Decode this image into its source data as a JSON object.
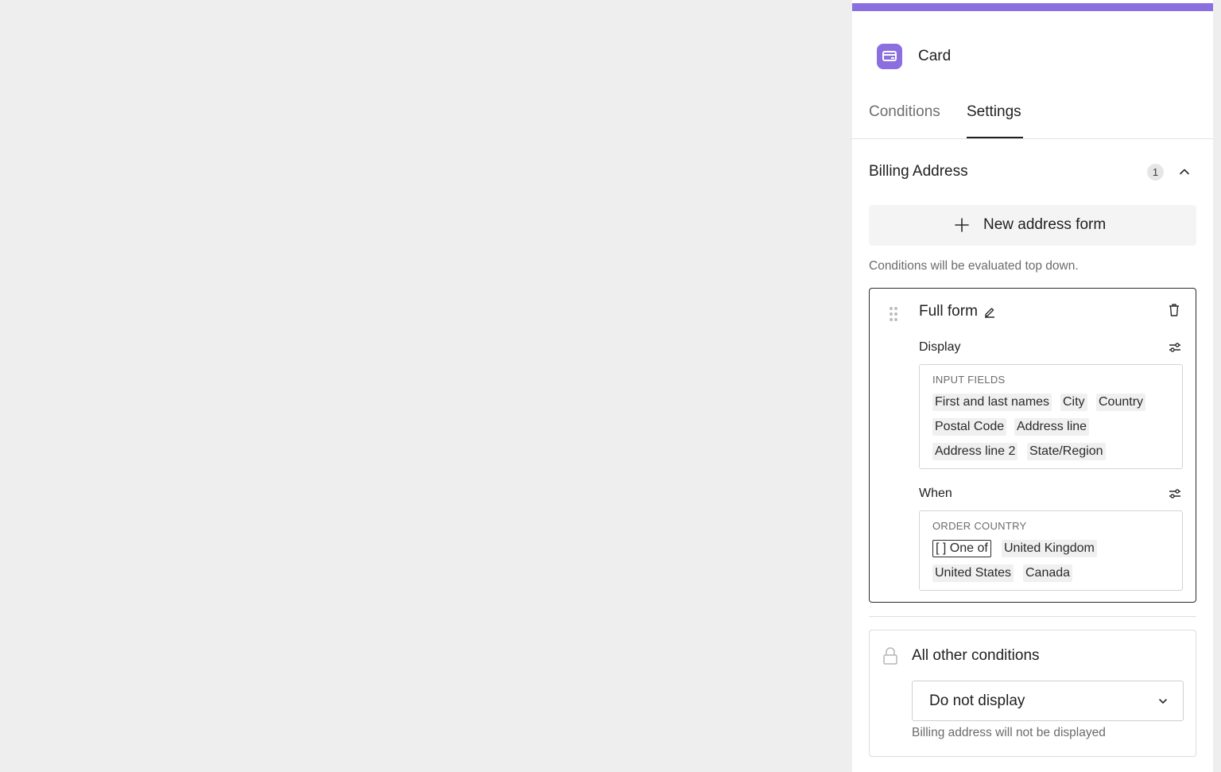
{
  "panel": {
    "accent_color": "#8b6fe0",
    "title": "Card",
    "title_icon": "card-icon"
  },
  "tabs": [
    {
      "label": "Conditions",
      "active": false
    },
    {
      "label": "Settings",
      "active": true
    }
  ],
  "section": {
    "title": "Billing Address",
    "count": "1",
    "collapse_icon": "chevron-up-icon"
  },
  "new_form_button": {
    "label": "New address form",
    "icon": "plus-icon"
  },
  "hint": "Conditions will be evaluated top down.",
  "rule": {
    "name": "Full form",
    "display": {
      "label": "Display",
      "box_heading": "INPUT FIELDS",
      "fields": [
        "First and last names",
        "City",
        "Country",
        "Postal Code",
        "Address line",
        "Address line 2",
        "State/Region"
      ]
    },
    "when": {
      "label": "When",
      "box_heading": "ORDER COUNTRY",
      "operator": "[ ] One of",
      "countries": [
        "United Kingdom",
        "United States",
        "Canada"
      ]
    }
  },
  "other": {
    "title": "All other conditions",
    "select_value": "Do not display",
    "help": "Billing address will not be displayed"
  }
}
